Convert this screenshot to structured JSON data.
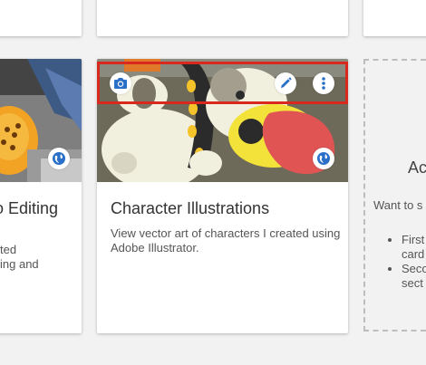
{
  "cards": {
    "left": {
      "title": "o Editing",
      "desc_line1": "ted",
      "desc_line2": "ing and"
    },
    "main": {
      "title": "Character Illustrations",
      "description": "View vector art of characters I created using Adobe Illustrator."
    },
    "add": {
      "title": "Ac",
      "text": "Want to s",
      "bullets": [
        "First",
        "card",
        "Seco",
        "sect"
      ]
    }
  },
  "icons": {
    "camera": "camera-icon",
    "edit": "pencil-icon",
    "more": "more-vertical-icon",
    "globe": "globe-icon"
  },
  "colors": {
    "accent": "#2a6fc8",
    "highlight": "#d9281e"
  }
}
